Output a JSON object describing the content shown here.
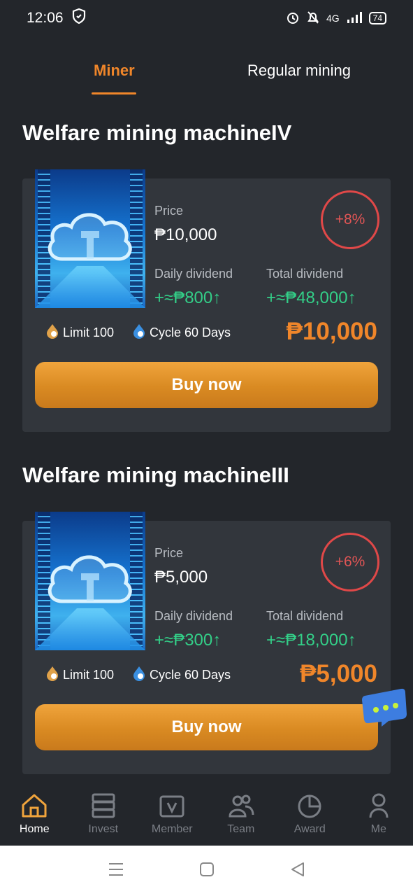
{
  "status_bar": {
    "time": "12:06",
    "network": "4G",
    "battery": "74"
  },
  "tabs": [
    {
      "label": "Miner",
      "active": true
    },
    {
      "label": "Regular mining",
      "active": false
    }
  ],
  "products": [
    {
      "title": "Welfare mining machineIV",
      "price_label": "Price",
      "price": "₱10,000",
      "percent": "+8%",
      "daily_label": "Daily dividend",
      "daily_value": "+≈₱800",
      "total_label": "Total dividend",
      "total_value": "+≈₱48,000",
      "limit": "Limit 100",
      "cycle": "Cycle 60 Days",
      "big_price": "₱10,000",
      "buy_label": "Buy now"
    },
    {
      "title": "Welfare mining machineIII",
      "price_label": "Price",
      "price": "₱5,000",
      "percent": "+6%",
      "daily_label": "Daily dividend",
      "daily_value": "+≈₱300",
      "total_label": "Total dividend",
      "total_value": "+≈₱18,000",
      "limit": "Limit 100",
      "cycle": "Cycle 60 Days",
      "big_price": "₱5,000",
      "buy_label": "Buy now"
    }
  ],
  "arrow_up": "↑",
  "bottom_nav": [
    {
      "label": "Home",
      "icon": "home-icon",
      "active": true
    },
    {
      "label": "Invest",
      "icon": "server-icon",
      "active": false
    },
    {
      "label": "Member",
      "icon": "member-icon",
      "active": false
    },
    {
      "label": "Team",
      "icon": "team-icon",
      "active": false
    },
    {
      "label": "Award",
      "icon": "pie-chart-icon",
      "active": false
    },
    {
      "label": "Me",
      "icon": "user-icon",
      "active": false
    }
  ],
  "colors": {
    "background": "#23262b",
    "card": "#32363c",
    "accent": "#f0862a",
    "green": "#33cf88",
    "red": "#e04848"
  }
}
